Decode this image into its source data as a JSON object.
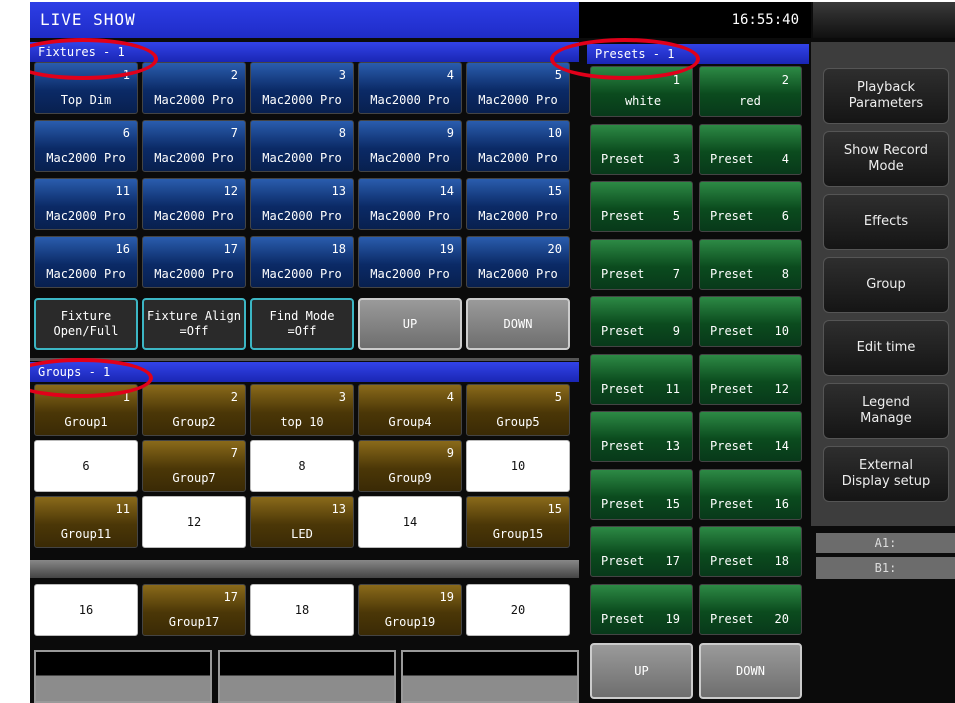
{
  "title": "LIVE SHOW",
  "clock": "16:55:40",
  "fixtures": {
    "header": "Fixtures - 1",
    "items": [
      {
        "num": "1",
        "label": "Top Dim"
      },
      {
        "num": "2",
        "label": "Mac2000 Pro"
      },
      {
        "num": "3",
        "label": "Mac2000 Pro"
      },
      {
        "num": "4",
        "label": "Mac2000 Pro"
      },
      {
        "num": "5",
        "label": "Mac2000 Pro"
      },
      {
        "num": "6",
        "label": "Mac2000 Pro"
      },
      {
        "num": "7",
        "label": "Mac2000 Pro"
      },
      {
        "num": "8",
        "label": "Mac2000 Pro"
      },
      {
        "num": "9",
        "label": "Mac2000 Pro"
      },
      {
        "num": "10",
        "label": "Mac2000 Pro"
      },
      {
        "num": "11",
        "label": "Mac2000 Pro"
      },
      {
        "num": "12",
        "label": "Mac2000 Pro"
      },
      {
        "num": "13",
        "label": "Mac2000 Pro"
      },
      {
        "num": "14",
        "label": "Mac2000 Pro"
      },
      {
        "num": "15",
        "label": "Mac2000 Pro"
      },
      {
        "num": "16",
        "label": "Mac2000 Pro"
      },
      {
        "num": "17",
        "label": "Mac2000 Pro"
      },
      {
        "num": "18",
        "label": "Mac2000 Pro"
      },
      {
        "num": "19",
        "label": "Mac2000 Pro"
      },
      {
        "num": "20",
        "label": "Mac2000 Pro"
      }
    ],
    "actions": [
      {
        "line1": "Fixture",
        "line2": "Open/Full"
      },
      {
        "line1": "Fixture Align",
        "line2": "=Off"
      },
      {
        "line1": "Find Mode",
        "line2": "=Off"
      }
    ],
    "up": "UP",
    "down": "DOWN"
  },
  "groups": {
    "header": "Groups - 1",
    "items": [
      {
        "num": "1",
        "label": "Group1",
        "filled": true
      },
      {
        "num": "2",
        "label": "Group2",
        "filled": true
      },
      {
        "num": "3",
        "label": "top 10",
        "filled": true
      },
      {
        "num": "4",
        "label": "Group4",
        "filled": true
      },
      {
        "num": "5",
        "label": "Group5",
        "filled": true
      },
      {
        "num": "6",
        "label": "",
        "filled": false
      },
      {
        "num": "7",
        "label": "Group7",
        "filled": true
      },
      {
        "num": "8",
        "label": "",
        "filled": false
      },
      {
        "num": "9",
        "label": "Group9",
        "filled": true
      },
      {
        "num": "10",
        "label": "",
        "filled": false
      },
      {
        "num": "11",
        "label": "Group11",
        "filled": true
      },
      {
        "num": "12",
        "label": "",
        "filled": false
      },
      {
        "num": "13",
        "label": "LED",
        "filled": true
      },
      {
        "num": "14",
        "label": "",
        "filled": false
      },
      {
        "num": "15",
        "label": "Group15",
        "filled": true
      },
      {
        "num": "16",
        "label": "",
        "filled": false
      },
      {
        "num": "17",
        "label": "Group17",
        "filled": true
      },
      {
        "num": "18",
        "label": "",
        "filled": false
      },
      {
        "num": "19",
        "label": "Group19",
        "filled": true
      },
      {
        "num": "20",
        "label": "",
        "filled": false
      }
    ]
  },
  "presets": {
    "header": "Presets - 1",
    "items": [
      {
        "num": "1",
        "label": "white"
      },
      {
        "num": "2",
        "label": "red"
      },
      {
        "num": "3",
        "label": "Preset"
      },
      {
        "num": "4",
        "label": "Preset"
      },
      {
        "num": "5",
        "label": "Preset"
      },
      {
        "num": "6",
        "label": "Preset"
      },
      {
        "num": "7",
        "label": "Preset"
      },
      {
        "num": "8",
        "label": "Preset"
      },
      {
        "num": "9",
        "label": "Preset"
      },
      {
        "num": "10",
        "label": "Preset"
      },
      {
        "num": "11",
        "label": "Preset"
      },
      {
        "num": "12",
        "label": "Preset"
      },
      {
        "num": "13",
        "label": "Preset"
      },
      {
        "num": "14",
        "label": "Preset"
      },
      {
        "num": "15",
        "label": "Preset"
      },
      {
        "num": "16",
        "label": "Preset"
      },
      {
        "num": "17",
        "label": "Preset"
      },
      {
        "num": "18",
        "label": "Preset"
      },
      {
        "num": "19",
        "label": "Preset"
      },
      {
        "num": "20",
        "label": "Preset"
      }
    ],
    "up": "UP",
    "down": "DOWN"
  },
  "sidebar": {
    "buttons": [
      {
        "line1": "Playback",
        "line2": "Parameters"
      },
      {
        "line1": "Show Record",
        "line2": "Mode"
      },
      {
        "line1": "Effects",
        "line2": ""
      },
      {
        "line1": "Group",
        "line2": ""
      },
      {
        "line1": "Edit time",
        "line2": ""
      },
      {
        "line1": "Legend",
        "line2": "Manage"
      },
      {
        "line1": "External",
        "line2": "Display setup"
      }
    ],
    "a1": "A1:",
    "b1": "B1:"
  },
  "colors": {
    "header_blue": "#2536d6",
    "fixture_blue": "#0b2a66",
    "preset_green": "#0b4b1e",
    "group_gold": "#4b3707",
    "highlight_red": "#e1001a",
    "action_cyan": "#3cb6c4"
  }
}
